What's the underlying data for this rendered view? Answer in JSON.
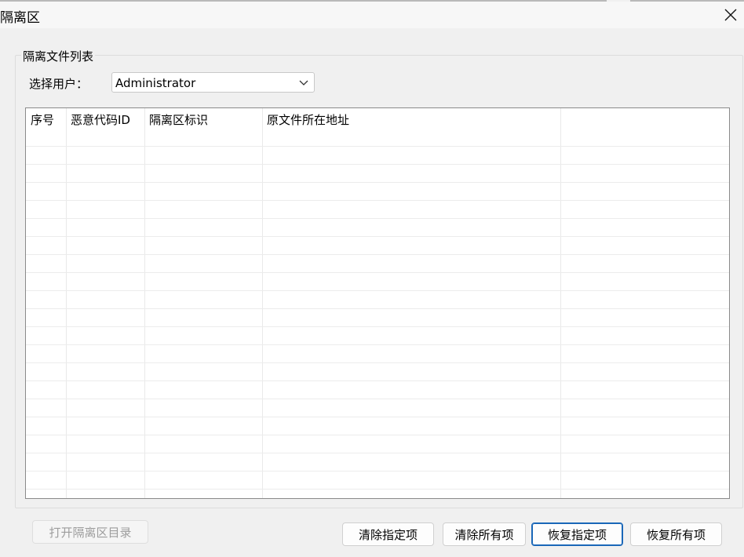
{
  "window": {
    "title": "隔离区"
  },
  "group": {
    "label": "隔离文件列表"
  },
  "user": {
    "label": "选择用户：",
    "selected": "Administrator"
  },
  "table": {
    "columns": [
      "序号",
      "恶意代码ID",
      "隔离区标识",
      "原文件所在地址",
      ""
    ],
    "rows": []
  },
  "buttons": {
    "open_dir": "打开隔离区目录",
    "clear_selected": "清除指定项",
    "clear_all": "清除所有项",
    "restore_selected": "恢复指定项",
    "restore_all": "恢复所有项"
  },
  "icons": {
    "close": "close-icon",
    "dropdown": "chevron-down-icon"
  }
}
